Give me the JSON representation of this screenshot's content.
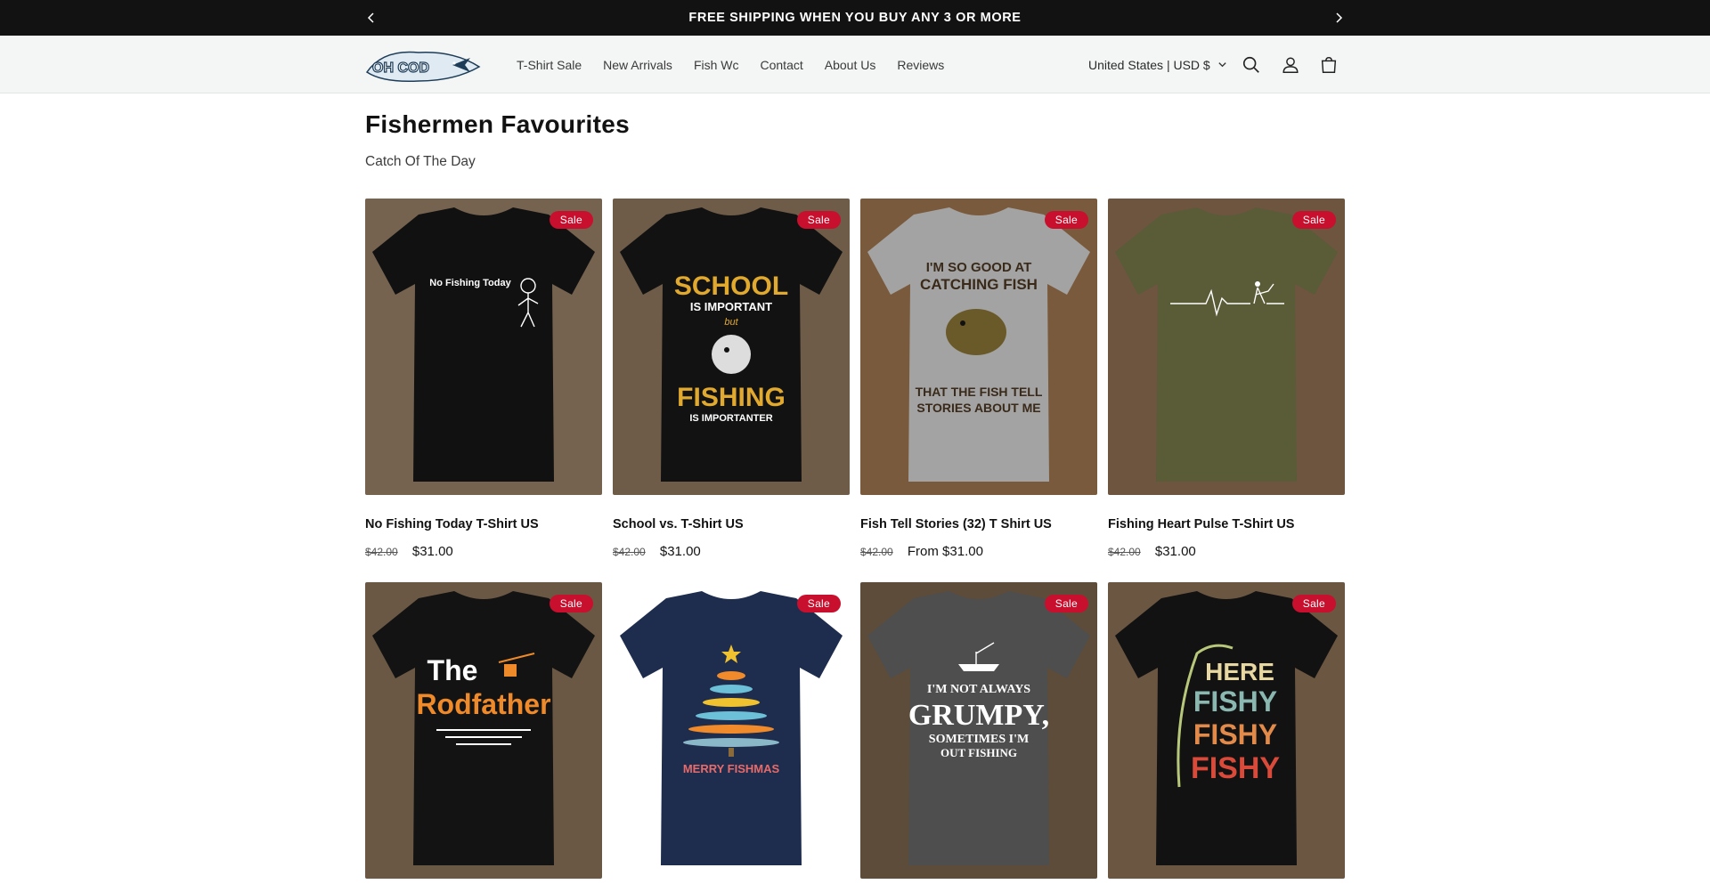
{
  "announcement": {
    "message": "FREE SHIPPING WHEN YOU BUY ANY 3 OR MORE"
  },
  "header": {
    "logo_text": "OH COD",
    "nav": [
      "T-Shirt Sale",
      "New Arrivals",
      "Fish Wc",
      "Contact",
      "About Us",
      "Reviews"
    ],
    "locale": "United States | USD $"
  },
  "collection": {
    "title": "Fishermen Favourites",
    "subtitle": "Catch Of The Day"
  },
  "products": [
    {
      "badge": "Sale",
      "title": "No Fishing Today T-Shirt US",
      "compare_price": "$42.00",
      "price": "$31.00",
      "shirt_color": "#111111",
      "print": [
        "No Fishing Today"
      ]
    },
    {
      "badge": "Sale",
      "title": "School vs. T-Shirt US",
      "compare_price": "$42.00",
      "price": "$31.00",
      "shirt_color": "#121212",
      "print": [
        "SCHOOL",
        "IS IMPORTANT",
        "but",
        "FISHING",
        "IS IMPORTANTER"
      ]
    },
    {
      "badge": "Sale",
      "title": "Fish Tell Stories (32) T Shirt US",
      "compare_price": "$42.00",
      "price": "From $31.00",
      "shirt_color": "#a3a3a3",
      "print": [
        "I'M SO GOOD AT",
        "CATCHING FISH",
        "THAT THE FISH TELL",
        "STORIES ABOUT ME"
      ]
    },
    {
      "badge": "Sale",
      "title": "Fishing Heart Pulse T-Shirt US",
      "compare_price": "$42.00",
      "price": "$31.00",
      "shirt_color": "#5a5b37",
      "print": []
    },
    {
      "badge": "Sale",
      "shirt_color": "#131313",
      "print": [
        "The",
        "Rodfather"
      ]
    },
    {
      "badge": "Sale",
      "shirt_color": "#1e2d4d",
      "print": [
        "MERRY FISHMAS"
      ]
    },
    {
      "badge": "Sale",
      "shirt_color": "#4e4e4e",
      "print": [
        "I'M NOT ALWAYS",
        "GRUMPY,",
        "SOMETIMES I'M",
        "OUT FISHING"
      ]
    },
    {
      "badge": "Sale",
      "shirt_color": "#121212",
      "print": [
        "HERE",
        "FISHY",
        "FISHY",
        "FISHY"
      ]
    }
  ]
}
